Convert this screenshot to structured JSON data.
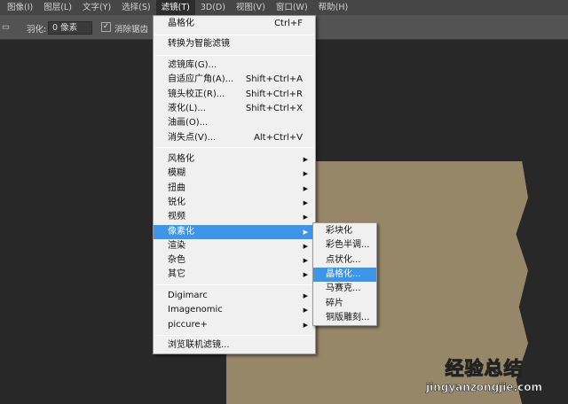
{
  "menubar": [
    "图像(I)",
    "图层(L)",
    "文字(Y)",
    "选择(S)",
    "滤镜(T)",
    "3D(D)",
    "视图(V)",
    "窗口(W)",
    "帮助(H)"
  ],
  "options": {
    "feather_label": "羽化:",
    "feather_value": "0 像素",
    "antialias_label": "消除锯齿",
    "left_icon": "选区"
  },
  "filter_menu": {
    "last_filter": {
      "label": "晶格化",
      "shortcut": "Ctrl+F"
    },
    "convert": "转换为智能滤镜",
    "group1": [
      {
        "label": "滤镜库(G)...",
        "shortcut": ""
      },
      {
        "label": "自适应广角(A)...",
        "shortcut": "Shift+Ctrl+A"
      },
      {
        "label": "镜头校正(R)...",
        "shortcut": "Shift+Ctrl+R"
      },
      {
        "label": "液化(L)...",
        "shortcut": "Shift+Ctrl+X"
      },
      {
        "label": "油画(O)...",
        "shortcut": ""
      },
      {
        "label": "消失点(V)...",
        "shortcut": "Alt+Ctrl+V"
      }
    ],
    "group2": [
      "风格化",
      "模糊",
      "扭曲",
      "锐化",
      "视频",
      "像素化",
      "渲染",
      "杂色",
      "其它"
    ],
    "group3": [
      "Digimarc",
      "Imagenomic",
      "piccure+"
    ],
    "browse": "浏览联机滤镜..."
  },
  "pixelate_submenu": [
    "彩块化",
    "彩色半调...",
    "点状化...",
    "晶格化...",
    "马赛克...",
    "碎片",
    "铜版雕刻..."
  ],
  "watermark": {
    "text1": "经验",
    "text2": "总结",
    "url": "jingyanzongjie.com"
  }
}
